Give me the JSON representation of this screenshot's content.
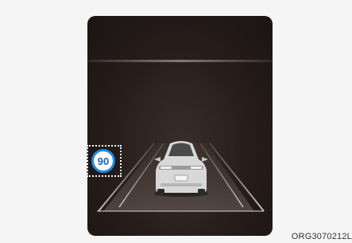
{
  "speed_limit": {
    "value": "90",
    "ring_color": "#1e88e5",
    "text_color": "#1565c0"
  },
  "vehicle": {
    "icon": "car-rear-icon",
    "color": "#d8d8d8"
  },
  "caption": "ORG3070212L"
}
